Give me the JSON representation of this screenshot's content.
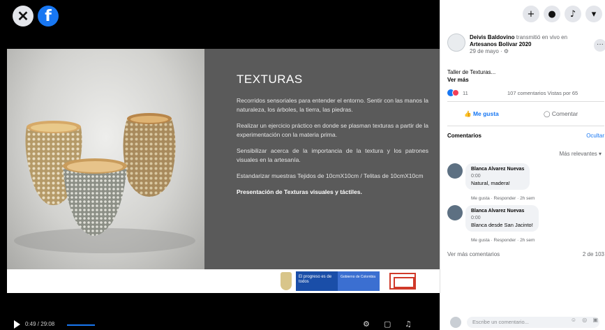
{
  "video": {
    "close_icon": "close-icon",
    "brand_icon": "facebook-icon",
    "brand_glyph": "f",
    "close_glyph": "✕",
    "slide": {
      "title": "TEXTURAS",
      "paragraphs": [
        "Recorridos sensoriales para entender el entorno. Sentir con las manos la naturaleza, los árboles, la tierra, las piedras.",
        "Realizar un ejercicio práctico en donde se plasman texturas a partir de la experimentación con la materia prima.",
        "Sensibilizar acerca de la importancia de la textura y los patrones visuales en la artesanía.",
        "Estandarizar muestras Tejidos de 10cmX10cm / Telitas de 10cmX10cm"
      ],
      "closing": "Presentación de Texturas visuales y táctiles.",
      "logo_gov_text": "El progreso es de todos",
      "logo_gov2_text": "Gobierno de Colombia"
    },
    "controls": {
      "time": "0:49 / 29:08",
      "play_icon": "play-icon",
      "settings_icon": "settings-icon",
      "volume_icon": "volume-icon"
    }
  },
  "sidebar": {
    "top_icons": [
      "plus-icon",
      "messenger-icon",
      "bell-icon",
      "chevron-down-icon"
    ],
    "top_glyphs": [
      "+",
      "●",
      "♪",
      "▾"
    ],
    "post": {
      "author": "Deivis Baldovino",
      "action": " transmitió en vivo en ",
      "group": "Artesanos Bolívar 2020",
      "date": "29 de mayo · ⚙",
      "more_glyph": "···",
      "description": "Taller de Texturas...",
      "see_more": "Ver más",
      "reaction_count": "11",
      "comments_views": "107 comentarios  Vistas por 65"
    },
    "actions": {
      "like": "👍 Me gusta",
      "comment": "◯ Comentar"
    },
    "comments_header": {
      "title": "Comentarios",
      "hide": "Ocultar",
      "relevance": "Más relevantes ▾"
    },
    "comments": [
      {
        "name": "Blanca Alvarez Nuevas",
        "time": "0:00",
        "text": "Natural, madera!",
        "actions": "Me gusta · Responder · 2h sem"
      },
      {
        "name": "Blanca Alvarez Nuevas",
        "time": "0:00",
        "text": "Blanca desde San Jacinto!",
        "actions": "Me gusta · Responder · 2h sem"
      }
    ],
    "more_comments": "Ver más comentarios",
    "more_comments_count": "2 de 103",
    "write_placeholder": "Escribe un comentario...",
    "write_icons": "☺ ◎ ▣"
  }
}
